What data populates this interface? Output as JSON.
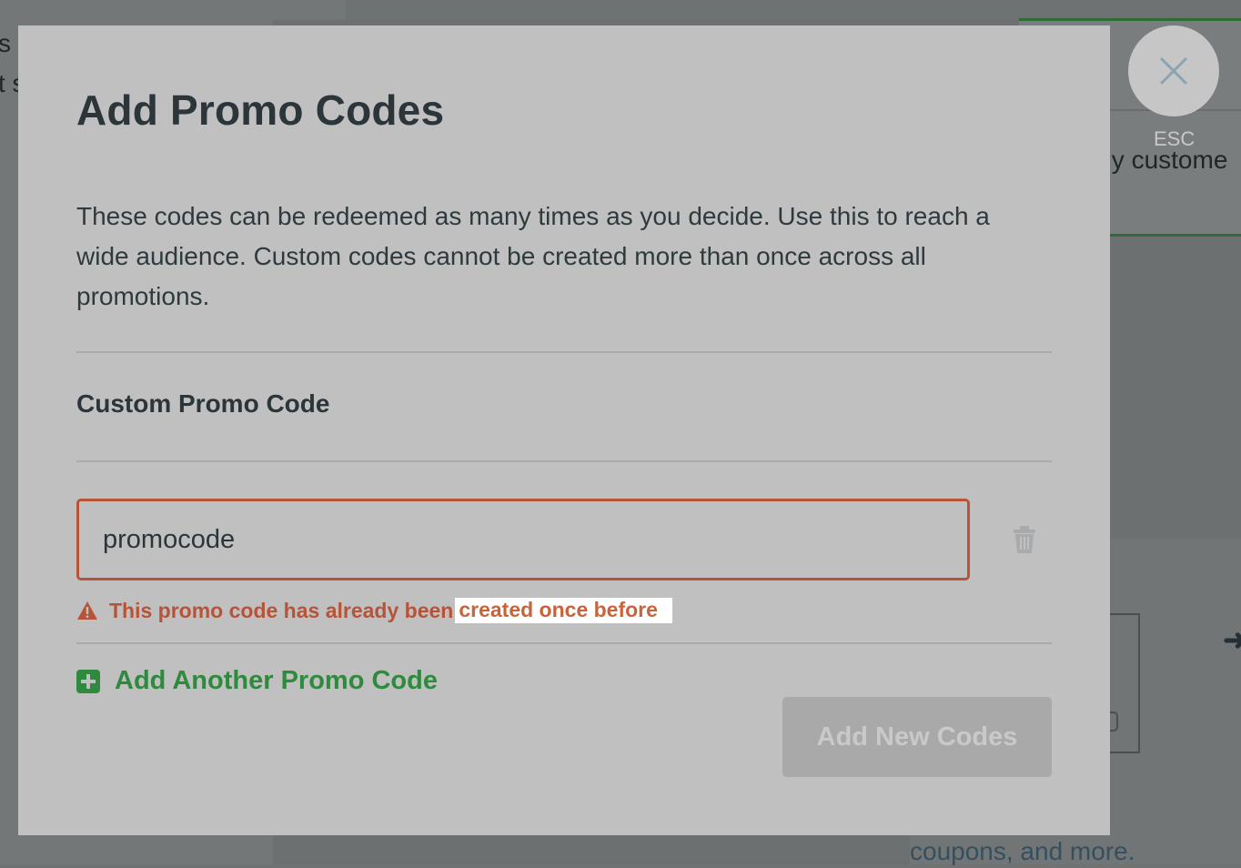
{
  "modal": {
    "title": "Add Promo Codes",
    "description": "These codes can be redeemed as many times as you decide. Use this to reach a wide audience. Custom codes cannot be created more than once across all promotions.",
    "section_heading": "Custom Promo Code",
    "code_input": {
      "value": "promocode"
    },
    "error": {
      "text": "This promo code has already been",
      "highlighted_text": "created once before"
    },
    "add_another_label": "Add Another Promo Code",
    "submit_label": "Add New Codes",
    "close_label": "ESC"
  },
  "background": {
    "right_card_text": "nly custome",
    "left_fragment_1": "s t",
    "left_fragment_2": "t s",
    "lower_text": "ils, on\nnted\ncoupons, and more."
  },
  "icons": {
    "close": "close-icon",
    "trash": "trash-icon",
    "warning": "warning-icon",
    "add": "plus-square-icon"
  },
  "colors": {
    "error": "#b6543a",
    "success": "#2f8a3e",
    "modal_background": "#c0c0c0",
    "disabled_button": "#a9a9a9"
  }
}
